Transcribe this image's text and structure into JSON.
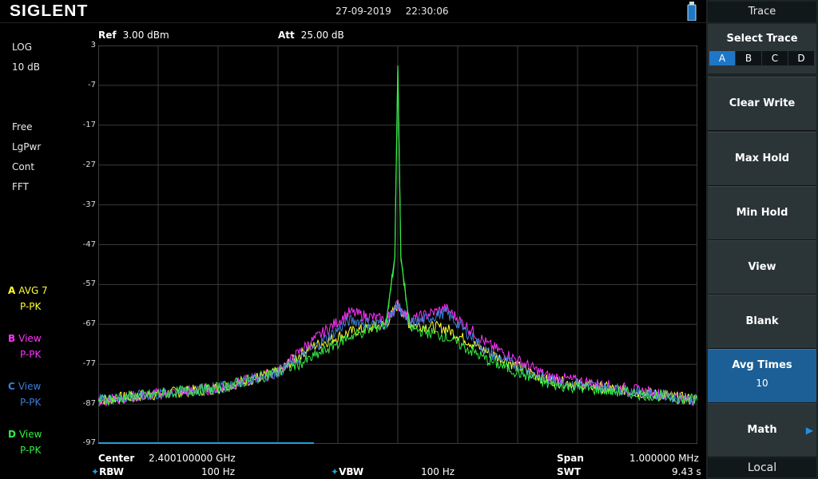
{
  "header": {
    "brand": "SIGLENT",
    "date": "27-09-2019",
    "time": "22:30:06",
    "usb_icon": "usb-icon"
  },
  "measurement": {
    "ref_label": "Ref",
    "ref_value": "3.00 dBm",
    "att_label": "Att",
    "att_value": "25.00 dB"
  },
  "left_info": {
    "scale_type": "LOG",
    "scale_div": "10 dB",
    "trig": "Free",
    "detector": "LgPwr",
    "sweep": "Cont",
    "mode": "FFT"
  },
  "traces": [
    {
      "key": "A",
      "mode": "AVG 7",
      "det": "P-PK",
      "color": "#ffff33"
    },
    {
      "key": "B",
      "mode": "View",
      "det": "P-PK",
      "color": "#ff33ff"
    },
    {
      "key": "C",
      "mode": "View",
      "det": "P-PK",
      "color": "#3d7fd6"
    },
    {
      "key": "D",
      "mode": "View",
      "det": "P-PK",
      "color": "#33ee44"
    }
  ],
  "y_axis": {
    "ticks": [
      "3",
      "-7",
      "-17",
      "-27",
      "-37",
      "-47",
      "-57",
      "-67",
      "-77",
      "-87",
      "-97"
    ]
  },
  "bottom": {
    "center_label": "Center",
    "center_value": "2.400100000 GHz",
    "span_label": "Span",
    "span_value": "1.000000 MHz",
    "rbw_label": "RBW",
    "rbw_value": "100 Hz",
    "vbw_label": "VBW",
    "vbw_value": "100 Hz",
    "swt_label": "SWT",
    "swt_value": "9.43 s"
  },
  "menu": {
    "title": "Trace",
    "select_trace_label": "Select Trace",
    "select_options": [
      "A",
      "B",
      "C",
      "D"
    ],
    "selected": "A",
    "buttons": [
      {
        "label": "Clear Write"
      },
      {
        "label": "Max Hold"
      },
      {
        "label": "Min Hold"
      },
      {
        "label": "View"
      },
      {
        "label": "Blank"
      },
      {
        "label": "Avg Times",
        "value": "10",
        "active": true
      },
      {
        "label": "Math",
        "has_submenu": true
      }
    ],
    "local_label": "Local"
  },
  "chart_data": {
    "type": "line",
    "title": "",
    "xlabel": "",
    "ylabel": "",
    "x_center_ghz": 2.4001,
    "x_span_mhz": 1.0,
    "x_unit": "MHz offset",
    "ylim": [
      -97,
      3
    ],
    "grid": true,
    "series": [
      {
        "name": "A",
        "color": "#ffff33",
        "points": [
          [
            -0.5,
            -86
          ],
          [
            -0.3,
            -83
          ],
          [
            -0.2,
            -79
          ],
          [
            -0.15,
            -73
          ],
          [
            -0.08,
            -69
          ],
          [
            -0.02,
            -67
          ],
          [
            0,
            -62
          ],
          [
            0.02,
            -67
          ],
          [
            0.08,
            -68
          ],
          [
            0.15,
            -74
          ],
          [
            0.25,
            -81
          ],
          [
            0.5,
            -86
          ]
        ]
      },
      {
        "name": "B",
        "color": "#ff33ff",
        "points": [
          [
            -0.5,
            -86
          ],
          [
            -0.3,
            -83
          ],
          [
            -0.2,
            -79
          ],
          [
            -0.15,
            -72
          ],
          [
            -0.08,
            -64
          ],
          [
            -0.02,
            -66
          ],
          [
            0,
            -62
          ],
          [
            0.02,
            -66
          ],
          [
            0.08,
            -63
          ],
          [
            0.15,
            -72
          ],
          [
            0.25,
            -80
          ],
          [
            0.5,
            -86
          ]
        ]
      },
      {
        "name": "C",
        "color": "#3d7fd6",
        "points": [
          [
            -0.5,
            -86
          ],
          [
            -0.3,
            -83
          ],
          [
            -0.2,
            -79
          ],
          [
            -0.15,
            -74
          ],
          [
            -0.08,
            -66
          ],
          [
            -0.02,
            -67
          ],
          [
            0,
            -62
          ],
          [
            0.02,
            -67
          ],
          [
            0.08,
            -64
          ],
          [
            0.15,
            -74
          ],
          [
            0.25,
            -81
          ],
          [
            0.5,
            -86
          ]
        ]
      },
      {
        "name": "D",
        "color": "#33ee44",
        "points": [
          [
            -0.5,
            -86
          ],
          [
            -0.3,
            -83
          ],
          [
            -0.2,
            -79
          ],
          [
            -0.15,
            -76
          ],
          [
            -0.08,
            -70
          ],
          [
            -0.02,
            -67
          ],
          [
            -0.005,
            -50
          ],
          [
            0,
            -2
          ],
          [
            0.005,
            -50
          ],
          [
            0.02,
            -68
          ],
          [
            0.08,
            -70
          ],
          [
            0.15,
            -76
          ],
          [
            0.25,
            -82
          ],
          [
            0.5,
            -86
          ]
        ]
      }
    ]
  }
}
